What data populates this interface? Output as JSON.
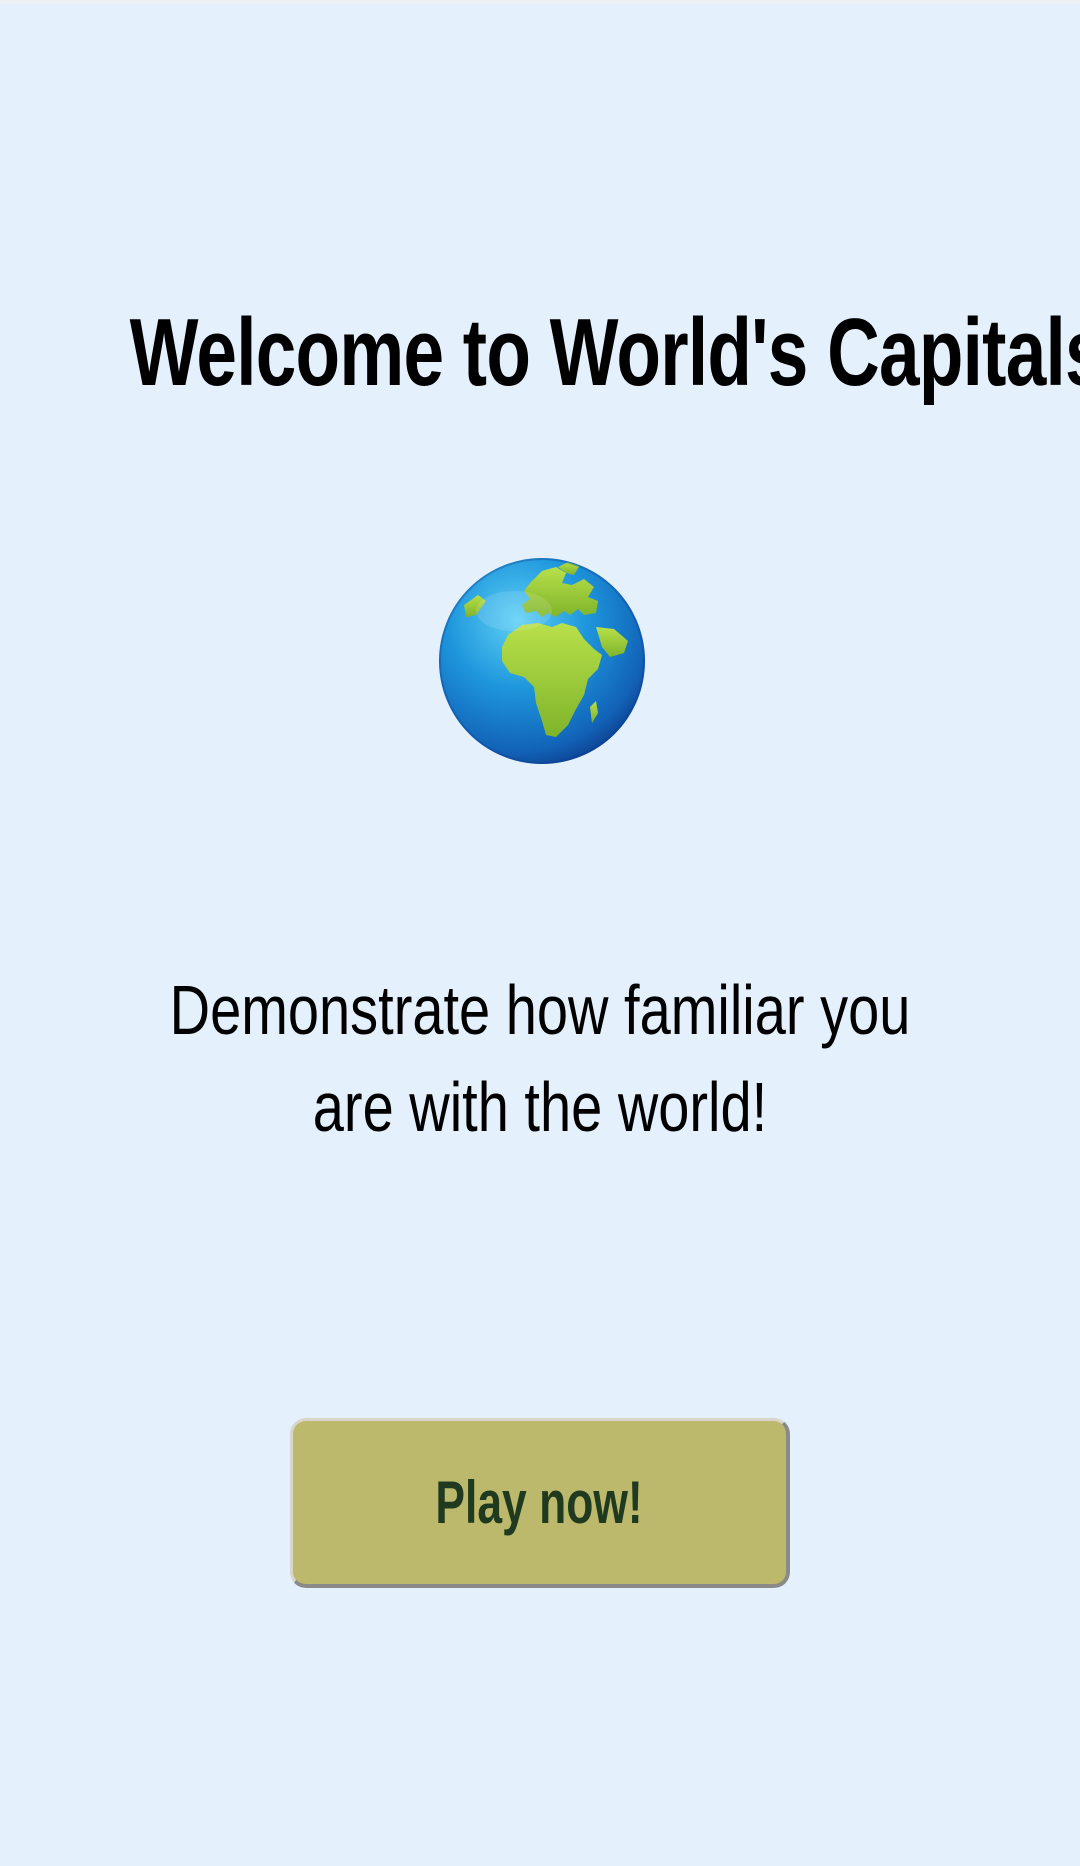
{
  "page": {
    "background_color": "#e4f1fd",
    "title": "Welcome to World's Capitals",
    "hero_icon": "globe-europe-africa-icon",
    "subtitle": "Demonstrate how familiar you are with the world!"
  },
  "play_button": {
    "label": "Play now!",
    "background_color": "#bcb86c",
    "text_color": "#1f3a1f"
  }
}
